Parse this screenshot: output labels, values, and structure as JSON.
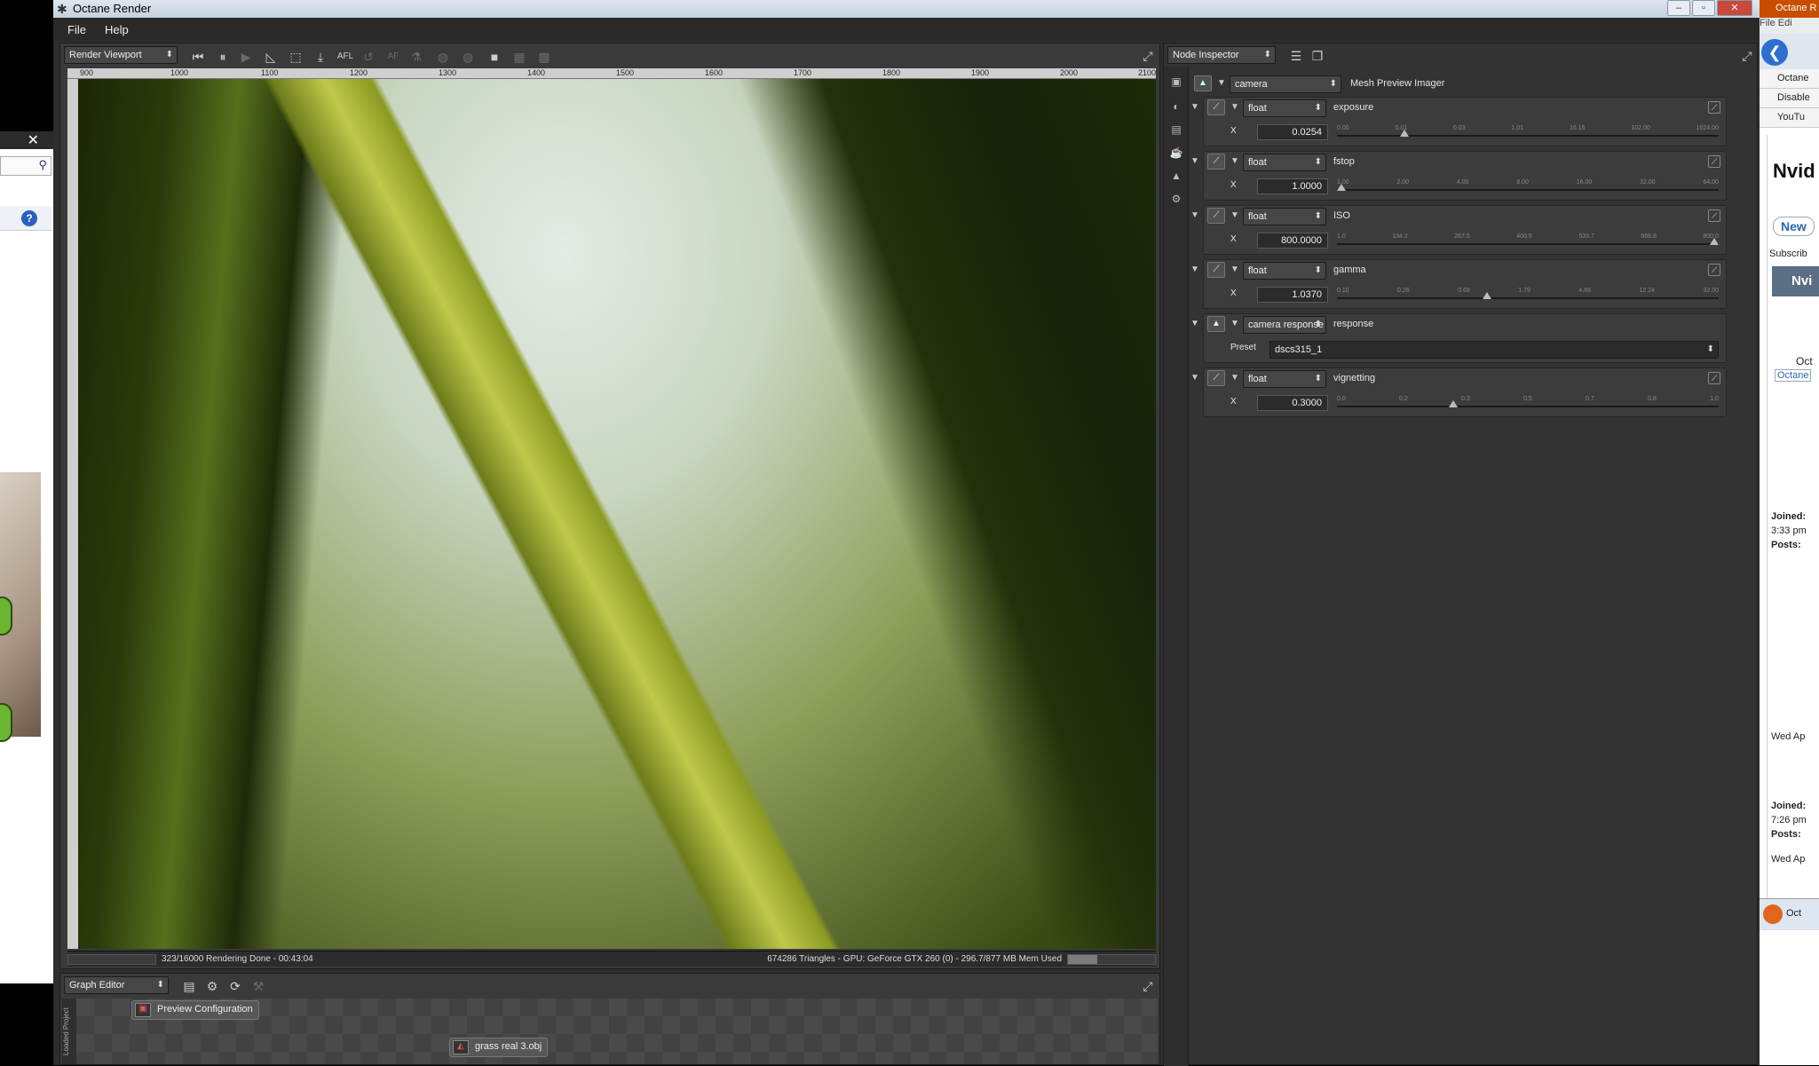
{
  "app": {
    "title": "Octane Render",
    "menu": [
      "File",
      "Help"
    ]
  },
  "viewport": {
    "panel_combo": "Render Viewport",
    "toolbar_text_afl": "AFL",
    "toolbar_text_af": "AF",
    "ruler_ticks": [
      "900",
      "1000",
      "1100",
      "1200",
      "1300",
      "1400",
      "1500",
      "1600",
      "1700",
      "1800",
      "1900",
      "2000",
      "2100"
    ],
    "status_left": "323/16000 Rendering Done - 00:43:04",
    "status_right": "674286 Triangles - GPU: GeForce GTX 260 (0) - 296.7/877 MB Mem Used",
    "mem_usage_fraction": 0.34
  },
  "graph_editor": {
    "panel_combo": "Graph Editor",
    "side_label": "Loaded Project",
    "nodes": [
      "Preview Configuration",
      "grass real 3.obj"
    ]
  },
  "inspector": {
    "panel_combo": "Node Inspector",
    "root_combo": "camera",
    "root_label": "Mesh Preview Imager",
    "params": [
      {
        "type": "float",
        "name": "exposure",
        "axis": "X",
        "value": "0.0254",
        "ticks": [
          "0.00",
          "0.01",
          "0.03",
          "1.01",
          "16.16",
          "102.00",
          "1024.00"
        ],
        "pos": 0.17
      },
      {
        "type": "float",
        "name": "fstop",
        "axis": "X",
        "value": "1.0000",
        "ticks": [
          "1.00",
          "2.00",
          "4.00",
          "8.00",
          "16.00",
          "32.00",
          "64.00"
        ],
        "pos": 0.0
      },
      {
        "type": "float",
        "name": "ISO",
        "axis": "X",
        "value": "800.0000",
        "ticks": [
          "1.0",
          "134.2",
          "267.5",
          "400.5",
          "533.7",
          "666.8",
          "800.0"
        ],
        "pos": 1.0
      },
      {
        "type": "float",
        "name": "gamma",
        "axis": "X",
        "value": "1.0370",
        "ticks": [
          "0.10",
          "0.26",
          "0.68",
          "1.79",
          "4.66",
          "12.24",
          "32.00"
        ],
        "pos": 0.39
      },
      {
        "type": "camera response",
        "name": "response",
        "axis": "Preset",
        "value": "dscs315_1",
        "ticks": [],
        "pos": null
      },
      {
        "type": "float",
        "name": "vignetting",
        "axis": "X",
        "value": "0.3000",
        "ticks": [
          "0.0",
          "0.2",
          "0.3",
          "0.5",
          "0.7",
          "0.8",
          "1.0"
        ],
        "pos": 0.3
      }
    ]
  },
  "browser": {
    "title": "Octane R",
    "menu": "File  Edi",
    "bookmarks": [
      "Octane",
      "Disable",
      "YouTu"
    ],
    "heading": "Nvid",
    "new_btn": "New",
    "subscribe": "Subscrib",
    "forum_bar": "Nvi",
    "octane_label": "Oct",
    "octane_link": "Octane",
    "joined_1": "Joined:",
    "time_1": "3:33 pm",
    "posts_1": "Posts:",
    "wed_1": "Wed Ap",
    "joined_2": "Joined:",
    "time_2": "7:26 pm",
    "posts_2": "Posts:",
    "wed_2": "Wed Ap",
    "taskbar": "Oct"
  },
  "colors": {
    "panel_bg": "#333333",
    "accent_green": "#bfc94a"
  }
}
